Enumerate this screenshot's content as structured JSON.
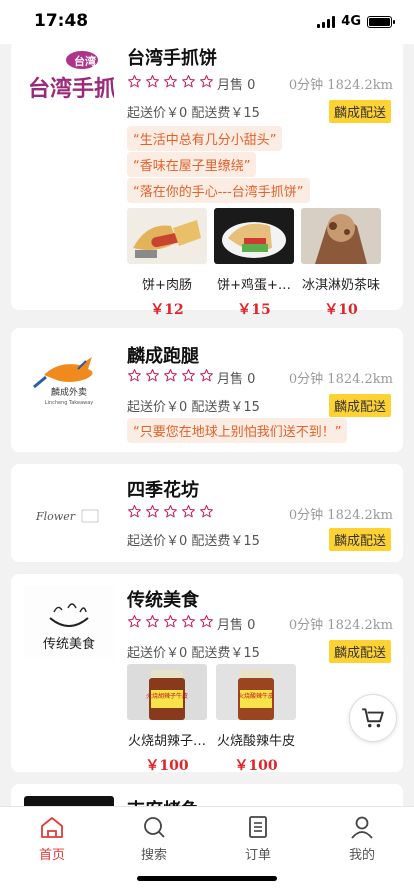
{
  "status_bar": {
    "time": "17:48",
    "network": "4G"
  },
  "shops": [
    {
      "name": "台湾手抓饼",
      "logo_text": "台湾手抓饼",
      "sold": "月售 0",
      "time_distance": "0分钟  1824.2km",
      "fees": "起送价￥0  配送费￥15",
      "badge": "麟成配送",
      "slogans": [
        "“生活中总有几分小甜头”",
        "“香味在屋子里缭绕”",
        "“落在你的手心---台湾手抓饼”"
      ],
      "items": [
        {
          "name": "饼+肉肠",
          "price": "￥12"
        },
        {
          "name": "饼+鸡蛋+…",
          "price": "￥15"
        },
        {
          "name": "冰淇淋奶茶味",
          "price": "￥10"
        }
      ]
    },
    {
      "name": "麟成跑腿",
      "logo_text": "麟成外卖",
      "logo_subtext": "Lincheng Takeaway",
      "sold": "月售 0",
      "time_distance": "0分钟  1824.2km",
      "fees": "起送价￥0  配送费￥15",
      "badge": "麟成配送",
      "slogans": [
        "“只要您在地球上别怕我们送不到！”"
      ]
    },
    {
      "name": "四季花坊",
      "logo_text": "Flower",
      "time_distance": "0分钟  1824.2km",
      "fees": "起送价￥0  配送费￥15",
      "badge": "麟成配送"
    },
    {
      "name": "传统美食",
      "logo_text": "传统美食",
      "sold": "月售 0",
      "time_distance": "0分钟  1824.2km",
      "fees": "起送价￥0  配送费￥15",
      "badge": "麟成配送",
      "items": [
        {
          "name": "火烧胡辣子…",
          "price": "￥100",
          "jar_label": "火烧胡辣子牛皮"
        },
        {
          "name": "火烧酸辣牛皮",
          "price": "￥100",
          "jar_label": "火烧酸辣牛皮"
        }
      ]
    },
    {
      "name": "吉府烤鱼"
    }
  ],
  "tabs": [
    {
      "label": "首页",
      "icon": "home-icon",
      "active": true
    },
    {
      "label": "搜索",
      "icon": "search-icon",
      "active": false
    },
    {
      "label": "订单",
      "icon": "order-icon",
      "active": false
    },
    {
      "label": "我的",
      "icon": "user-icon",
      "active": false
    }
  ],
  "colors": {
    "accent": "#e53935",
    "badge": "#ffd233",
    "price": "#e0242a",
    "slogan_bg": "#fbece4",
    "slogan_text": "#e2622a",
    "star": "#c2185b"
  }
}
